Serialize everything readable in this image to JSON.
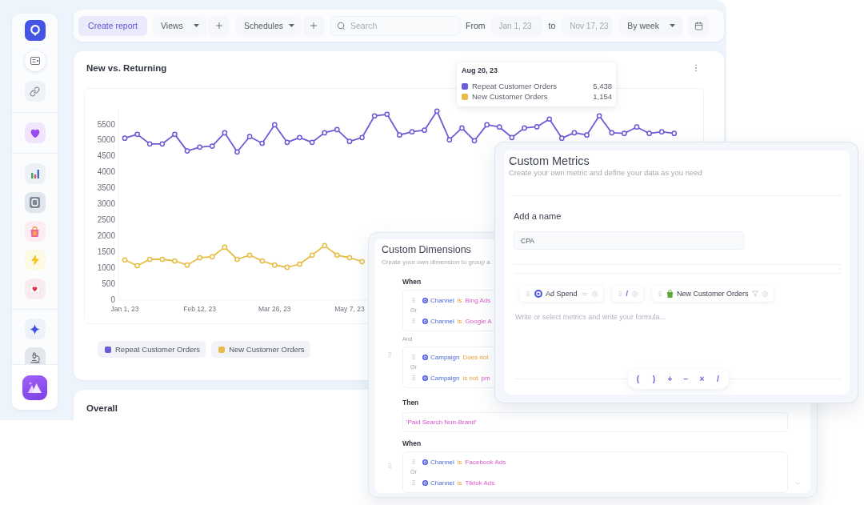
{
  "toolbar": {
    "create_button": {
      "label": "Create report"
    },
    "views_dropdown": {
      "label": "Views"
    },
    "schedules_dropdown": {
      "label": "Schedules"
    },
    "search": {
      "placeholder": "Search"
    },
    "from_label": "From",
    "from_date": {
      "placeholder": "Jan 1, 23"
    },
    "to_label": "to",
    "to_date": {
      "placeholder": "Nov 17, 23"
    },
    "interval_dropdown": {
      "label": "By week"
    }
  },
  "chart_card": {
    "title": "New vs. Returning",
    "chart_data": {
      "type": "line",
      "categories": [
        "Jan 1, 23",
        null,
        null,
        null,
        null,
        null,
        "Feb 12, 23",
        null,
        null,
        null,
        null,
        null,
        "Mar 26, 23",
        null,
        null,
        null,
        null,
        null,
        "May 7, 23",
        null,
        null,
        null,
        null,
        null,
        null,
        null,
        null,
        null,
        null,
        null,
        null,
        null,
        null,
        null,
        null,
        null,
        null,
        null,
        null,
        null,
        null,
        null,
        null,
        null,
        null,
        null
      ],
      "ylim": [
        0,
        6000
      ],
      "yticks": [
        0,
        500,
        1000,
        1500,
        2000,
        2500,
        3000,
        3500,
        4000,
        4500,
        5000,
        5500
      ],
      "series": [
        {
          "name": "Repeat Customer Orders",
          "color": "#6b5bd6",
          "marker": "circle",
          "values": [
            5080,
            5200,
            4900,
            4900,
            5200,
            4680,
            4800,
            4830,
            5250,
            4650,
            5130,
            4920,
            5500,
            4950,
            5100,
            4950,
            5250,
            5350,
            4980,
            5100,
            5780,
            5830,
            5180,
            5280,
            5330,
            5930,
            5030,
            5400,
            5000,
            5500,
            5430,
            5100,
            5400,
            5438,
            5680,
            5080,
            5250,
            5180,
            5780,
            5250,
            5230,
            5430,
            5230,
            5280,
            5230,
            null
          ]
        },
        {
          "name": "New Customer Orders",
          "color": "#e6bd45",
          "marker": "circle",
          "values": [
            1260,
            1080,
            1280,
            1280,
            1230,
            1100,
            1330,
            1360,
            1660,
            1280,
            1410,
            1230,
            1100,
            1030,
            1130,
            1410,
            1710,
            1410,
            1330,
            1210,
            null,
            null,
            null,
            null,
            null,
            null,
            null,
            null,
            null,
            null,
            null,
            null,
            null,
            null,
            null,
            null,
            null,
            null,
            null,
            null,
            null,
            null,
            null,
            null,
            null,
            null
          ]
        }
      ]
    },
    "tooltip": {
      "title": "Aug 20, 23",
      "rows": [
        {
          "label": "Repeat Customer Orders",
          "value": "5,438",
          "color": "#6b5bd6"
        },
        {
          "label": "New Customer Orders",
          "value": "1,154",
          "color": "#e6bd45"
        }
      ]
    }
  },
  "overall_card": {
    "title": "Overall"
  },
  "custom_dimensions": {
    "title": "Custom Dimensions",
    "subtitle": "Create your own dimension to group a",
    "rules": [
      {
        "when_label": "When",
        "groups": [
          {
            "conditions": [
              {
                "field": "Channel",
                "operator": "is",
                "value": "Bing Ads"
              },
              {
                "field": "Channel",
                "operator": "is",
                "value": "Google A"
              }
            ],
            "joiner": "Or"
          },
          {
            "conditions": [
              {
                "field": "Campaign",
                "operator": "Does not"
              },
              {
                "field": "Campaign",
                "operator": "is not",
                "value": "pm"
              }
            ],
            "joiner": "Or"
          }
        ],
        "group_joiner": "And",
        "then_label": "Then",
        "then_value": "'Paid Search Non-Brand'"
      },
      {
        "when_label": "When",
        "groups": [
          {
            "conditions": [
              {
                "field": "Channel",
                "operator": "is",
                "value": "Facebook Ads"
              },
              {
                "field": "Channel",
                "operator": "is",
                "value": "Tiktok Ads"
              }
            ],
            "joiner": "Or"
          }
        ]
      }
    ]
  },
  "custom_metrics": {
    "title": "Custom Metrics",
    "subtitle": "Create your own metric and define your data as you need",
    "name_label": "Add a name",
    "name_field": {
      "value": "CPA"
    },
    "formula": {
      "tokens": [
        {
          "kind": "ads_metric",
          "label": "Ad Spend"
        },
        {
          "kind": "operator",
          "label": "/"
        },
        {
          "kind": "store_metric",
          "label": "New Customer Orders"
        }
      ],
      "placeholder": "Write or select metrics and write your formula..."
    },
    "operators": [
      "(",
      ")",
      "+",
      "−",
      "×",
      "/"
    ]
  }
}
